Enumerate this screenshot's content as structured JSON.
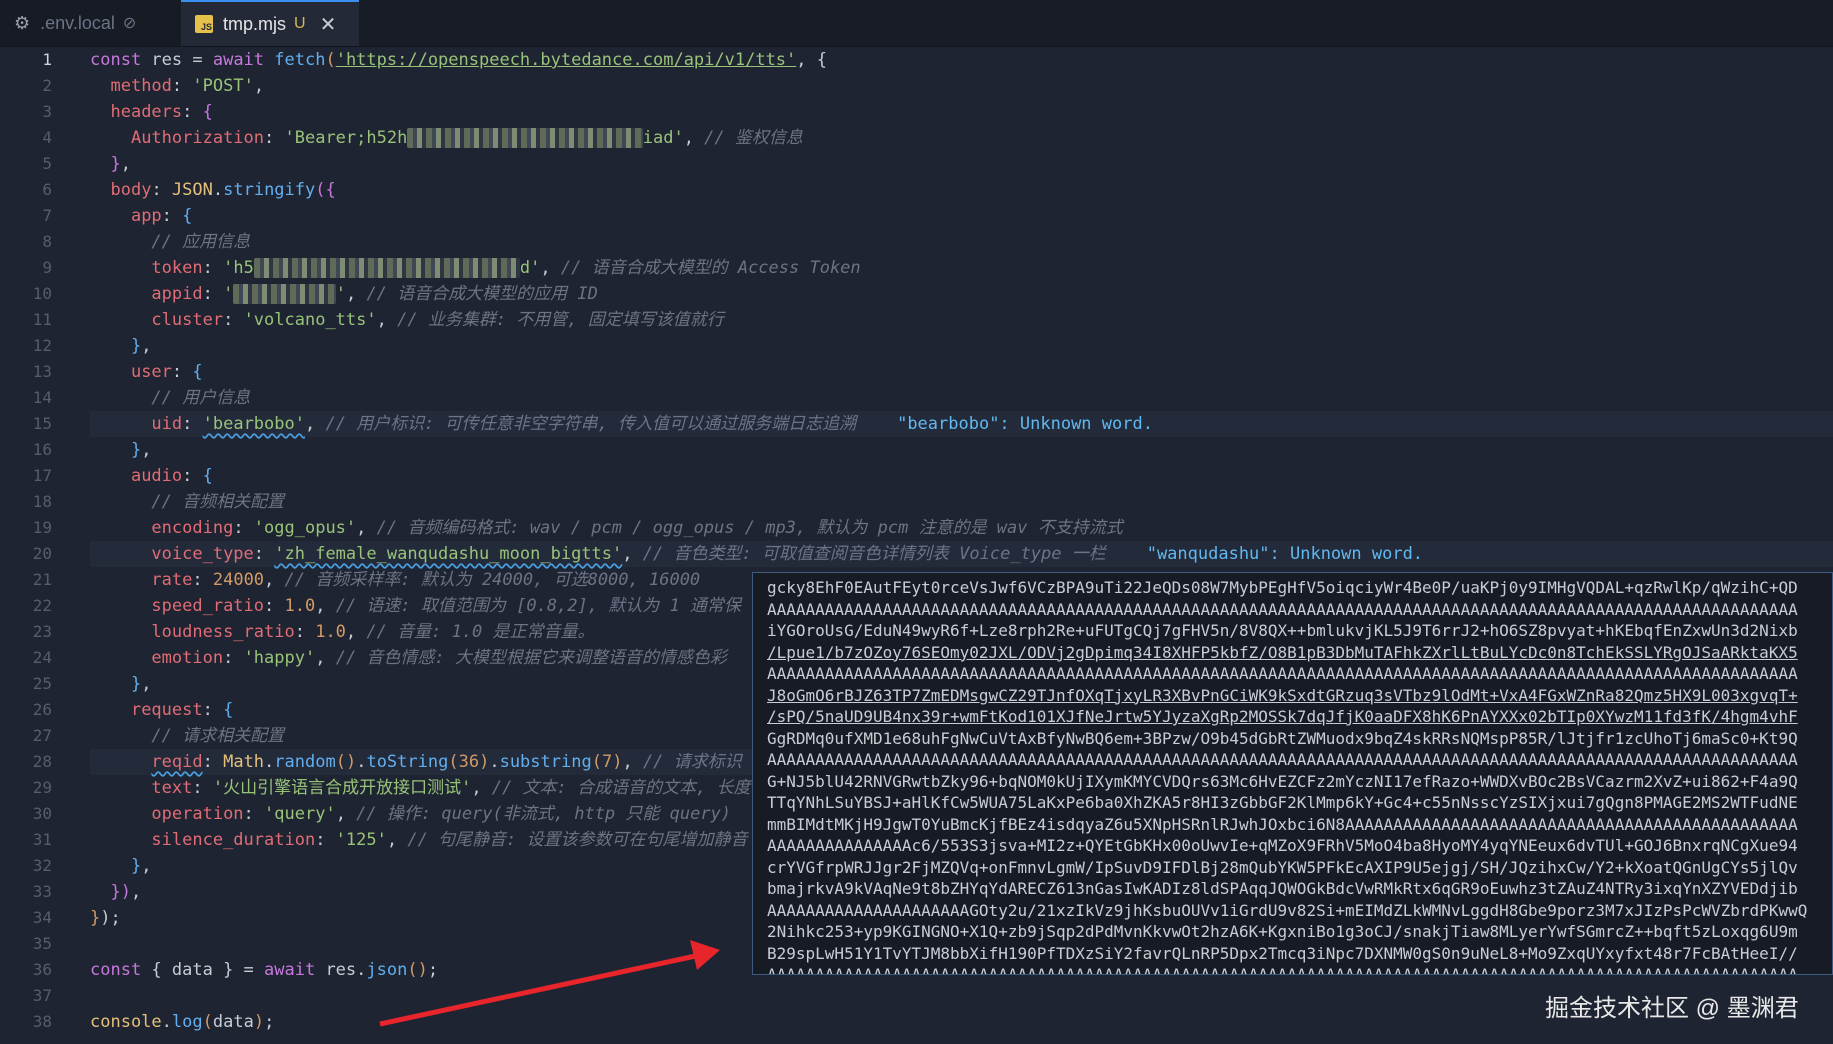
{
  "tabs": [
    {
      "label": ".env.local",
      "icon": "gear-icon",
      "marker": "⊘"
    },
    {
      "label": "tmp.mjs",
      "icon": "js-file-icon",
      "icon_text": "JS",
      "marker": "U",
      "close": "✕"
    }
  ],
  "line_numbers": [
    "1",
    "2",
    "3",
    "4",
    "5",
    "6",
    "7",
    "8",
    "9",
    "10",
    "11",
    "12",
    "13",
    "14",
    "15",
    "16",
    "17",
    "18",
    "19",
    "20",
    "21",
    "22",
    "23",
    "24",
    "25",
    "26",
    "27",
    "28",
    "29",
    "30",
    "31",
    "32",
    "33",
    "34",
    "35",
    "36",
    "37",
    "38"
  ],
  "code": {
    "l1": {
      "kw": "const",
      "var": " res = ",
      "await": "await",
      "fetch": " fetch",
      "open": "(",
      "url": "'https://openspeech.bytedance.com/api/v1/tts'",
      "rest": ", {"
    },
    "l2": {
      "prop": "method",
      "str": "'POST'"
    },
    "l3": {
      "prop": "headers"
    },
    "l4": {
      "prop": "Authorization",
      "str_a": "'Bearer;h52h",
      "str_b": "iad'",
      "cm": "// 鉴权信息"
    },
    "l6": {
      "prop": "body",
      "obj": "JSON",
      "fn": "stringify"
    },
    "l7": {
      "prop": "app"
    },
    "l8": {
      "cm": "// 应用信息"
    },
    "l9": {
      "prop": "token",
      "str_a": "'h5",
      "str_b": "d'",
      "cm": "// 语音合成大模型的 Access Token"
    },
    "l10": {
      "prop": "appid",
      "str_a": "'",
      "str_b": "'",
      "cm": "// 语音合成大模型的应用 ID"
    },
    "l11": {
      "prop": "cluster",
      "str": "'volcano_tts'",
      "cm": "// 业务集群: 不用管, 固定填写该值就行"
    },
    "l13": {
      "prop": "user"
    },
    "l14": {
      "cm": "// 用户信息"
    },
    "l15": {
      "prop": "uid",
      "str": "'bearbobo'",
      "cm": "// 用户标识: 可传任意非空字符串, 传入值可以通过服务端日志追溯",
      "warn": "\"bearbobo\": Unknown word."
    },
    "l17": {
      "prop": "audio"
    },
    "l18": {
      "cm": "// 音频相关配置"
    },
    "l19": {
      "prop": "encoding",
      "str": "'ogg_opus'",
      "cm": "// 音频编码格式: wav / pcm / ogg_opus / mp3, 默认为 pcm 注意的是 wav 不支持流式"
    },
    "l20": {
      "prop": "voice_type",
      "str": "'zh_female_wanqudashu_moon_bigtts'",
      "cm": "// 音色类型: 可取值查阅音色详情列表 Voice_type 一栏",
      "warn": "\"wanqudashu\": Unknown word."
    },
    "l21": {
      "prop": "rate",
      "num": "24000",
      "cm": "// 音频采样率: 默认为 24000, 可选8000, 16000"
    },
    "l22": {
      "prop": "speed_ratio",
      "num": "1.0",
      "cm": "// 语速: 取值范围为 [0.8,2], 默认为 1 通常保"
    },
    "l23": {
      "prop": "loudness_ratio",
      "num": "1.0",
      "cm": "// 音量: 1.0 是正常音量。"
    },
    "l24": {
      "prop": "emotion",
      "str": "'happy'",
      "cm": "// 音色情感: 大模型根据它来调整语音的情感色彩"
    },
    "l26": {
      "prop": "request"
    },
    "l27": {
      "cm": "// 请求相关配置"
    },
    "l28": {
      "prop": "reqid",
      "obj": "Math",
      "fn1": "random",
      "fn2": "toString",
      "num1": "36",
      "fn3": "substring",
      "num2": "7",
      "cm": "// 请求标识"
    },
    "l29": {
      "prop": "text",
      "str": "'火山引擎语言合成开放接口测试'",
      "cm": "// 文本: 合成语音的文本, 长度"
    },
    "l30": {
      "prop": "operation",
      "str": "'query'",
      "cm": "// 操作: query(非流式, http 只能 query)"
    },
    "l31": {
      "prop": "silence_duration",
      "str": "'125'",
      "cm": "// 句尾静音: 设置该参数可在句尾增加静音"
    },
    "l36": {
      "kw": "const",
      "destructure": " { data } = ",
      "await": "await",
      "obj": " res",
      "fn": "json"
    },
    "l38": {
      "obj": "console",
      "fn": "log",
      "arg": "data"
    }
  },
  "popup_lines": [
    "gcky8EhF0EAutFEyt0rceVsJwf6VCzBPA9uTi22JeQDs08W7MybPEgHfV5oiqciyWr4Be0P/uaKPj0y9IMHgVQDAL+qzRwlKp/qWzihC+QD",
    "AAAAAAAAAAAAAAAAAAAAAAAAAAAAAAAAAAAAAAAAAAAAAAAAAAAAAAAAAAAAAAAAAAAAAAAAAAAAAAAAAAAAAAAAAAAAAAAAAAAAAAAAAAA",
    "iYGOroUsG/EduN49wyR6f+Lze8rph2Re+uFUTgCQj7gFHV5n/8V8QX++bmlukvjKL5J9T6rrJ2+hO6SZ8pvyat+hKEbqfEnZxwUn3d2Nixb",
    "/Lpue1/b7zOZoy76SEOmy02JXL/ODVj2gDpimq34I8XHFP5kbfZ/O8B1pB3DbMuTAFhkZXrlLtBuLYcDc0n8TchEkSSLYRgOJSaARktaKX5",
    "AAAAAAAAAAAAAAAAAAAAAAAAAAAAAAAAAAAAAAAAAAAAAAAAAAAAAAAAAAAAAAAAAAAAAAAAAAAAAAAAAAAAAAAAAAAAAAAAAAAAAAAAAAA",
    "J8oGmO6rBJZ63TP7ZmEDMsgwCZ29TJnfOXqTjxyLR3XBvPnGCiWK9kSxdtGRzuq3sVTbz9lOdMt+VxA4FGxWZnRa82Qmz5HX9L003xgvqT+",
    "/sPQ/5naUD9UB4nx39r+wmFtKod101XJfNeJrtw5YJyzaXgRp2MOSSk7dqJfjK0aaDFX8hK6PnAYXXx02bTIp0XYwzM11fd3fK/4hgm4vhF",
    "GgRDMq0ufXMD1e68uhFgNwCuVtAxBfyNwBQ6em+3BPzw/O9b45dGbRtZWMuodx9bqZ4skRRsNQMspP85R/lJtjfr1zcUhoTj6maSc0+Kt9Q",
    "AAAAAAAAAAAAAAAAAAAAAAAAAAAAAAAAAAAAAAAAAAAAAAAAAAAAAAAAAAAAAAAAAAAAAAAAAAAAAAAAAAAAAAAAAAAAAAAAAAAAAAAAAAA",
    "G+NJ5blU42RNVGRwtbZky96+bqNOM0kUjIXymKMYCVDQrs63Mc6HvEZCFz2mYczNI17efRazo+WWDXvBOc2BsVCazrm2XvZ+ui862+F4a9Q",
    "TTqYNhLSuYBSJ+aHlKfCw5WUA75LaKxPe6ba0XhZKA5r8HI3zGbbGF2KlMmp6kY+Gc4+c55nNsscYzSIXjxui7gQgn8PMAGE2MS2WTFudNE",
    "mmBIMdtMKjH9JgwT0YuBmcKjfBEz4isdqyaZ6u5XNpHSRnlRJwhJOxbci6N8AAAAAAAAAAAAAAAAAAAAAAAAAAAAAAAAAAAAAAAAAAAAAAA",
    "AAAAAAAAAAAAAAAc6/553S3jsva+MI2z+QYEtGbKHx00oUwvIe+qMZoX9FRhV5MoO4ba8HyoMY4yqYNEeux6dvTUl+GOJ6BnxrqNCgXue94",
    "crYVGfrpWRJJgr2FjMZQVq+onFmnvLgmW/IpSuvD9IFDlBj28mQubYKW5PFkEcAXIP9U5ejgj/SH/JQzihxCw/Y2+kXoatQGnUgCYs5jlQv",
    "bmajrkvA9kVAqNe9t8bZHYqYdARECZ613nGasIwKADIz8ldSPAqqJQWOGkBdcVwRMkRtx6qGR9oEuwhz3tZAuZ4NTRy3ixqYnXZYVEDdjib",
    "AAAAAAAAAAAAAAAAAAAAAGOty2u/21xzIkVz9jhKsbuOUVv1iGrdU9v82Si+mEIMdZLkWMNvLggdH8Gbe9porz3M7xJIzPsPcWVZbrdPKwwQ",
    "2Nihkc253+yp9KGINGNO+X1Q+zb9jSqp2dPdMvnKkvwOt2hzA6K+KgxniBo1g3oCJ/snakjTiaw8MLyerYwfSGmrcZ++bqft5zLoxqg6U9m",
    "B29spLwH51Y1TvYTJM8bbXifH190PfTDXzSiY2favrQLnRP5Dpx2Tmcq3iNpc7DXNMW0gS0n9uNeL8+Mo9ZxqUYxyfxt48r7FcBAtHeeI//",
    "AAAAAAAAAAAAAAAAAAAAAAAAAAAAAAAAAAAAAAAAAAAAAAAAAAAAAAAAAAAAAAAAAAAAAAAAAAAAAAAAAAAAAAAAAAAAAAAAAAAAAAAAAAA"
  ],
  "watermark": "掘金技术社区 @ 墨渊君",
  "colors": {
    "background": "#1e2431",
    "string": "#98c379",
    "property": "#e06c75",
    "keyword": "#c678dd",
    "function": "#61afef",
    "comment": "#6b7385",
    "arrow": "#e8252b"
  }
}
